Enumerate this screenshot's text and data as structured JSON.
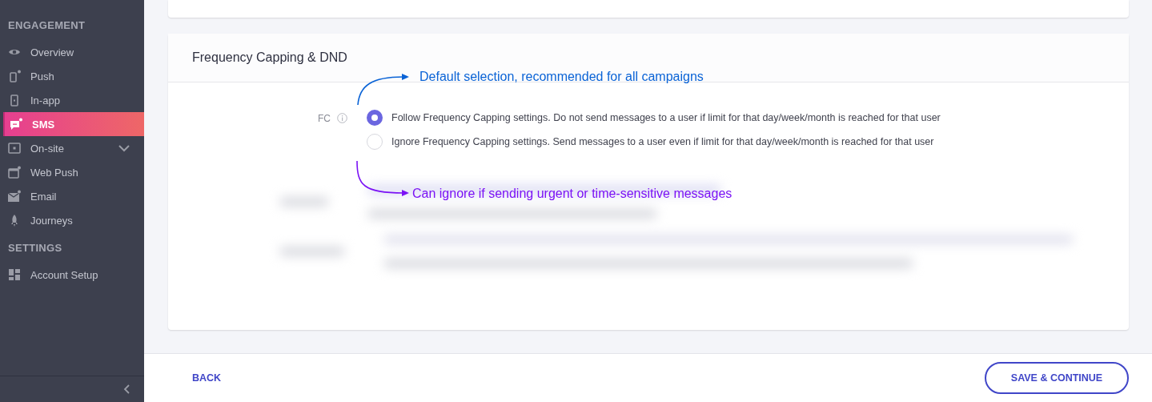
{
  "sidebar": {
    "sections": [
      {
        "title": "ENGAGEMENT",
        "items": [
          {
            "label": "Overview",
            "kind": "eye",
            "selected": false
          },
          {
            "label": "Push",
            "kind": "phone",
            "selected": false
          },
          {
            "label": "In-app",
            "kind": "tablet",
            "selected": false
          },
          {
            "label": "SMS",
            "kind": "chat",
            "selected": true
          },
          {
            "label": "On-site",
            "kind": "screen",
            "selected": false,
            "expandable": true
          },
          {
            "label": "Web Push",
            "kind": "window",
            "selected": false
          },
          {
            "label": "Email",
            "kind": "mail",
            "selected": false
          },
          {
            "label": "Journeys",
            "kind": "rocket",
            "selected": false
          }
        ]
      },
      {
        "title": "SETTINGS",
        "items": [
          {
            "label": "Account Setup",
            "kind": "grid",
            "selected": false
          }
        ]
      }
    ]
  },
  "card": {
    "title": "Frequency Capping & DND",
    "field_label": "FC",
    "options": [
      {
        "label": "Follow Frequency Capping settings. Do not send messages to a user if limit for that day/week/month is reached for that user",
        "selected": true
      },
      {
        "label": "Ignore Frequency Capping settings. Send messages to a user even if limit for that day/week/month is reached for that user",
        "selected": false
      }
    ]
  },
  "annotations": [
    {
      "text": "Default selection, recommended for all campaigns",
      "color": "#0a63d6"
    },
    {
      "text": "Can ignore if sending urgent or time-sensitive messages",
      "color": "#7b12f5"
    }
  ],
  "footer": {
    "back": "BACK",
    "save": "SAVE & CONTINUE"
  }
}
